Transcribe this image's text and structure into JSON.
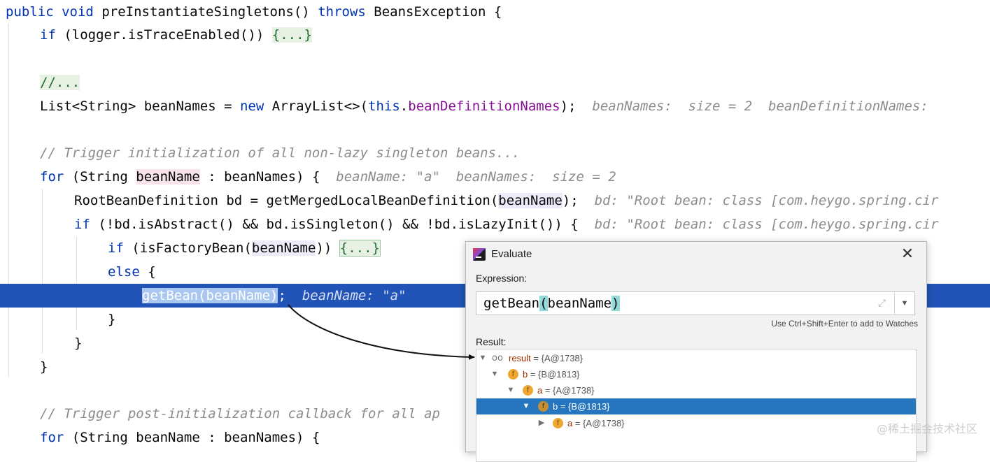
{
  "code": {
    "line1": {
      "kw1": "public",
      "kw2": "void",
      "method": "preInstantiateSingletons",
      "after": "() ",
      "kw3": "throws",
      "rest": " BeansException {"
    },
    "line2": {
      "kw": "if",
      "text": " (logger.isTraceEnabled()) ",
      "fold": "{...}"
    },
    "line3": {
      "fold": "//..."
    },
    "line4": {
      "pre": "List<String> beanNames = ",
      "kw1": "new",
      "mid": " ArrayList<>(",
      "kw2": "this",
      "dot": ".",
      "field": "beanDefinitionNames",
      "end": ");",
      "inlay": "beanNames:  size = 2  beanDefinitionNames: "
    },
    "line5": {
      "comment": "// Trigger initialization of all non-lazy singleton beans..."
    },
    "line6": {
      "kw": "for",
      "pre": " (String ",
      "var": "beanName",
      "post": " : beanNames) {",
      "inlay": "beanName: \"a\"  beanNames:  size = 2"
    },
    "line7": {
      "pre": "RootBeanDefinition bd = getMergedLocalBeanDefinition(",
      "var": "beanName",
      "post": ");",
      "inlay": "bd: \"Root bean: class [com.heygo.spring.cir"
    },
    "line8": {
      "kw": "if",
      "text": " (!bd.isAbstract() && bd.isSingleton() && !bd.isLazyInit()) {",
      "inlay": "bd: \"Root bean: class [com.heygo.spring.cir"
    },
    "line9": {
      "kw": "if",
      "pre": " (isFactoryBean(",
      "var": "beanName",
      "post": ")) ",
      "fold": "{...}"
    },
    "line10": {
      "kw": "else",
      "text": " {"
    },
    "line11": {
      "sel": "getBean(beanName)",
      "semi": ";",
      "inlay": "beanName: \"a\""
    },
    "line12": {
      "text": "}"
    },
    "line13": {
      "text": "}"
    },
    "line14": {
      "text": "}"
    },
    "line15": {
      "comment": "// Trigger post-initialization callback for all ap"
    },
    "line16": {
      "kw": "for",
      "text": " (String beanName : beanNames) {"
    }
  },
  "dialog": {
    "title": "Evaluate",
    "close": "✕",
    "expression_label": "Expression:",
    "expression": {
      "fn": "getBean",
      "open": "(",
      "arg": "beanName",
      "close": ")"
    },
    "expand_glyph": "⤢",
    "dropdown_glyph": "▼",
    "hint": "Use Ctrl+Shift+Enter to add to Watches",
    "result_label": "Result:",
    "tree": [
      {
        "name": "result",
        "value": " = {A@1738}",
        "expanded": true,
        "kind": "watch"
      },
      {
        "name": "b",
        "value": " = {B@1813}",
        "expanded": true,
        "kind": "field"
      },
      {
        "name": "a",
        "value": " = {A@1738}",
        "expanded": true,
        "kind": "field"
      },
      {
        "name": "b",
        "value": " = {B@1813}",
        "expanded": true,
        "kind": "field",
        "selected": true
      },
      {
        "name": "a",
        "value": " = {A@1738}",
        "expanded": false,
        "kind": "field"
      }
    ],
    "badge_letter": "f",
    "watch_glyph": "oo",
    "tri_down": "▼",
    "tri_right": "▶"
  },
  "watermark": "@稀土掘金技术社区",
  "colors": {
    "current_line": "#2154b6",
    "selected_node": "#2675bf",
    "keyword": "#0033b3",
    "field": "#871094",
    "field_badge": "#f0a732"
  }
}
